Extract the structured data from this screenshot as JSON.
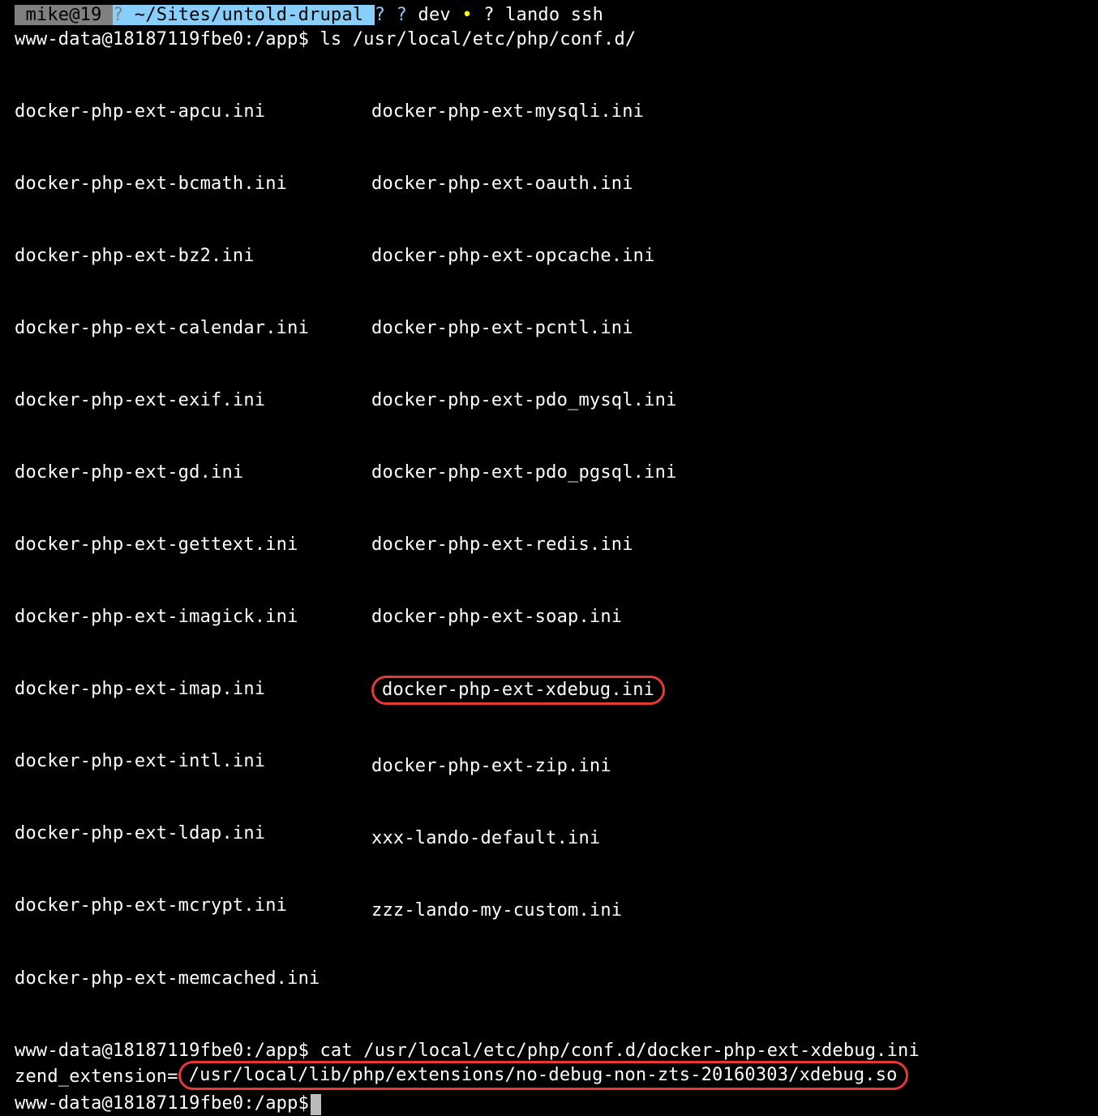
{
  "status": {
    "host": " mike@19 ",
    "branch_icon1": "?",
    "path": " ~/Sites/untold-drupal ",
    "branch_icon2": "?",
    "branch_icon3": "?",
    "branch": " dev ",
    "dirty": "• ",
    "branch_icon4": "?",
    "command": " lando ssh"
  },
  "p1": {
    "prompt": "www-data@18187119fbe0:/app$ ",
    "cmd": "ls /usr/local/etc/php/conf.d/"
  },
  "ls": {
    "col1": [
      "docker-php-ext-apcu.ini",
      "docker-php-ext-bcmath.ini",
      "docker-php-ext-bz2.ini",
      "docker-php-ext-calendar.ini",
      "docker-php-ext-exif.ini",
      "docker-php-ext-gd.ini",
      "docker-php-ext-gettext.ini",
      "docker-php-ext-imagick.ini",
      "docker-php-ext-imap.ini",
      "docker-php-ext-intl.ini",
      "docker-php-ext-ldap.ini",
      "docker-php-ext-mcrypt.ini",
      "docker-php-ext-memcached.ini"
    ],
    "col2": [
      "docker-php-ext-mysqli.ini",
      "docker-php-ext-oauth.ini",
      "docker-php-ext-opcache.ini",
      "docker-php-ext-pcntl.ini",
      "docker-php-ext-pdo_mysql.ini",
      "docker-php-ext-pdo_pgsql.ini",
      "docker-php-ext-redis.ini",
      "docker-php-ext-soap.ini",
      "docker-php-ext-xdebug.ini",
      "docker-php-ext-zip.ini",
      "xxx-lando-default.ini",
      "zzz-lando-my-custom.ini",
      ""
    ]
  },
  "p2": {
    "prompt": "www-data@18187119fbe0:/app$ ",
    "cmd": "cat /usr/local/etc/php/conf.d/docker-php-ext-xdebug.ini"
  },
  "out": {
    "pre": "zend_extension=",
    "hl": "/usr/local/lib/php/extensions/no-debug-non-zts-20160303/xdebug.so"
  },
  "p3": {
    "prompt": "www-data@18187119fbe0:/app$"
  }
}
